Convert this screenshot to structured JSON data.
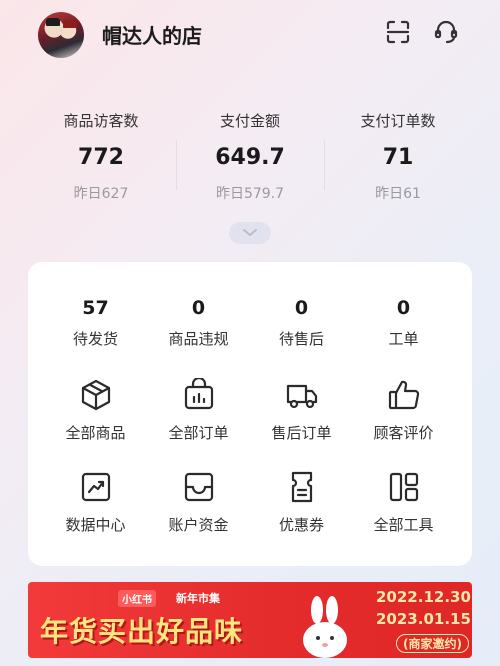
{
  "header": {
    "store_name": "帽达人的店",
    "icons": [
      "scan-icon",
      "customer-service-icon"
    ]
  },
  "stats": [
    {
      "label": "商品访客数",
      "value": "772",
      "yesterday": "昨日627"
    },
    {
      "label": "支付金额",
      "value": "649.7",
      "yesterday": "昨日579.7"
    },
    {
      "label": "支付订单数",
      "value": "71",
      "yesterday": "昨日61"
    }
  ],
  "todo": [
    {
      "count": "57",
      "label": "待发货"
    },
    {
      "count": "0",
      "label": "商品违规"
    },
    {
      "count": "0",
      "label": "待售后"
    },
    {
      "count": "0",
      "label": "工单"
    }
  ],
  "tools": [
    {
      "label": "全部商品",
      "icon": "box-icon"
    },
    {
      "label": "全部订单",
      "icon": "order-bag-icon"
    },
    {
      "label": "售后订单",
      "icon": "truck-icon"
    },
    {
      "label": "顾客评价",
      "icon": "thumbs-up-icon"
    },
    {
      "label": "数据中心",
      "icon": "trend-chart-icon"
    },
    {
      "label": "账户资金",
      "icon": "wallet-tray-icon"
    },
    {
      "label": "优惠券",
      "icon": "coupon-icon"
    },
    {
      "label": "全部工具",
      "icon": "grid-tools-icon"
    }
  ],
  "banner": {
    "tag_brand": "小红书",
    "tag_event": "新年市集",
    "headline": "年货买出好品味",
    "date_start": "2022.12.30",
    "date_end": "2023.01.15",
    "invite": "(商家邀约)"
  }
}
